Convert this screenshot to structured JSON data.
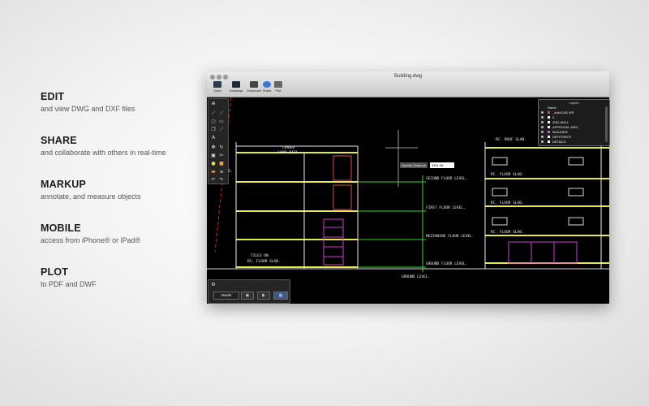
{
  "features": [
    {
      "title": "EDIT",
      "desc": "and view DWG and DXF files"
    },
    {
      "title": "SHARE",
      "desc": "and collaborate with others in real-time"
    },
    {
      "title": "MARKUP",
      "desc": "annotate, and measure objects"
    },
    {
      "title": "MOBILE",
      "desc": "access from iPhone® or iPad®"
    },
    {
      "title": "PLOT",
      "desc": "to PDF and DWF"
    }
  ],
  "window": {
    "title": "Building.dwg",
    "toolbar": [
      "Open",
      "Drawings",
      "Download",
      "Share",
      "Plot"
    ]
  },
  "layers": {
    "title": "Layers",
    "header": "Name",
    "items": [
      {
        "name": "_AutoCAD WS",
        "color": "#ff3b3b"
      },
      {
        "name": "0",
        "color": "#ffffff"
      },
      {
        "name": "2ND-WALL",
        "color": "#ffffff"
      },
      {
        "name": "APPROVAL-DRG",
        "color": "#ffffff"
      },
      {
        "name": "BUILDING",
        "color": "#ff40ff"
      },
      {
        "name": "DEFPOINTS",
        "color": "#ffffff"
      },
      {
        "name": "DETAILS",
        "color": "#ffffff"
      }
    ]
  },
  "measure": {
    "label": "Specify Distance",
    "value": "3401.08"
  },
  "bottom": {
    "model": "Model"
  },
  "drawing": {
    "labels": {
      "timber": "TIMBER",
      "handrail": "HAND RAIL.",
      "second_floor": "SECOND FLOOR LEVEL.",
      "first_floor": "FIRST FLOOR LEVEL.",
      "mezzanine": "MEZZANINE FLOOR LEVEL.",
      "ground_floor": "GROUND FLOOR LEVEL.",
      "ground_level": "GROUND LEVEL.",
      "tiles_on": "TILES ON",
      "rc_floor_slab_left": "RC. FLOOR SLAB.",
      "rc_roof_slab": "RC. ROOF SLAB.",
      "rc_floor_slab_1": "RC. FLOOR SLAB.",
      "rc_floor_slab_2": "RC. FLOOR SLAB.",
      "rc_floor_slab_3": "RC. FLOOR SLAB.",
      "de": "DE."
    }
  },
  "colors": {
    "cad_yellow": "#e8e84a",
    "cad_green": "#3cd23c",
    "cad_magenta": "#d23cd2",
    "cad_white": "#eeeeee",
    "cad_red": "#cc2a2a"
  }
}
